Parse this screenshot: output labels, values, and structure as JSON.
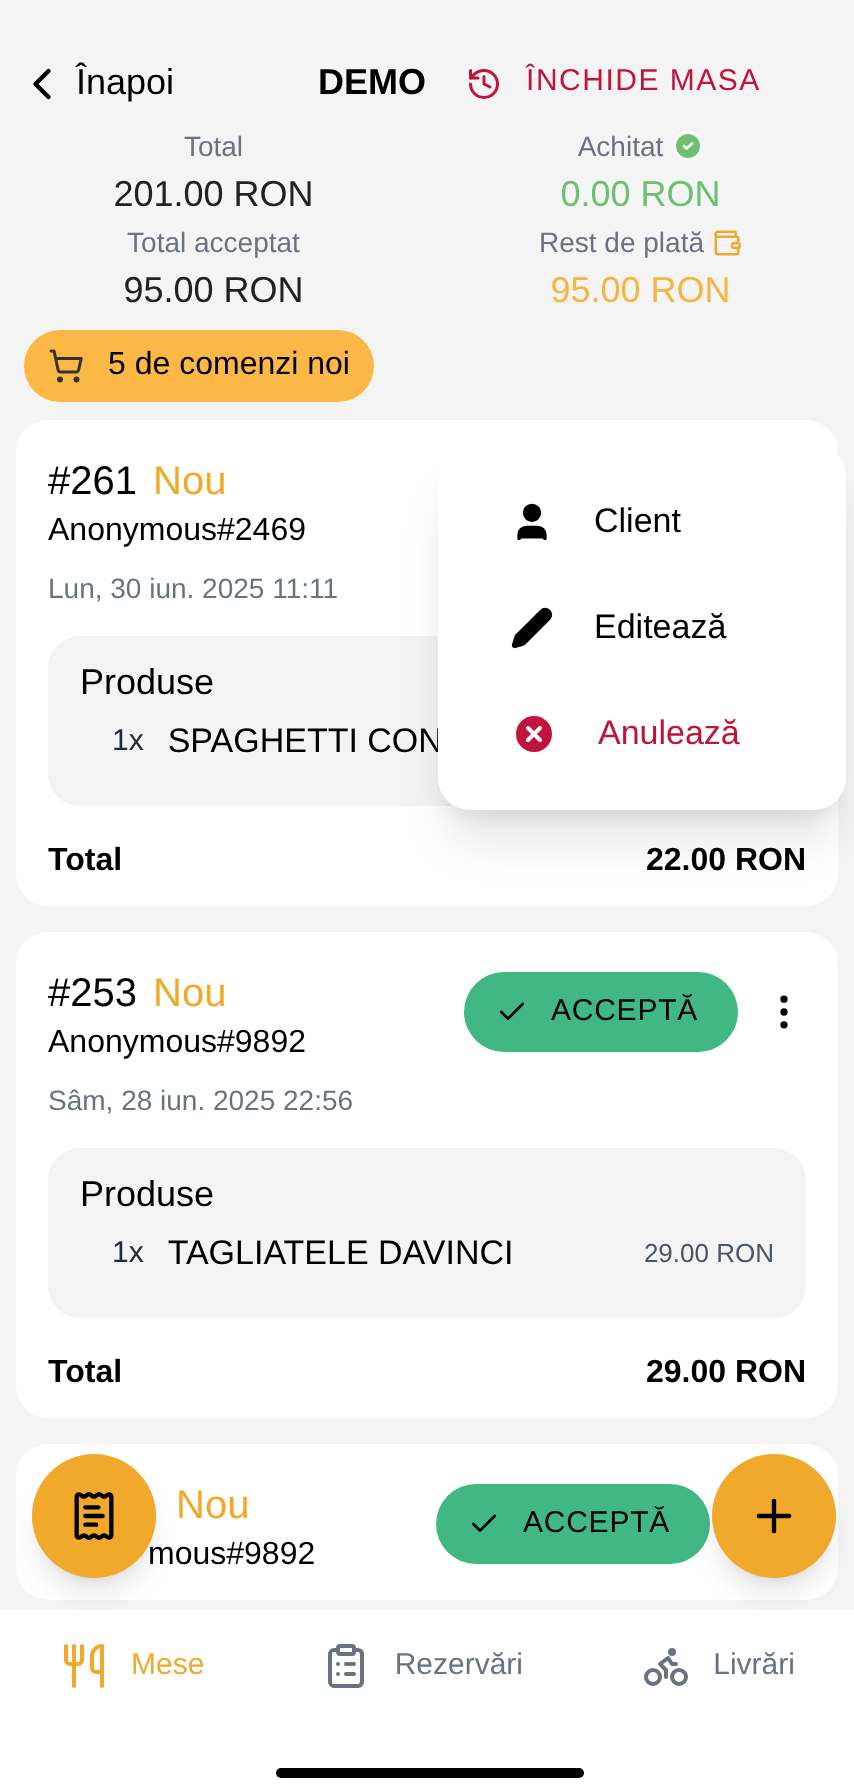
{
  "header": {
    "back_label": "Înapoi",
    "title": "DEMO",
    "close_label": "ÎNCHIDE MASA"
  },
  "summary": [
    {
      "label": "Total",
      "value": "201.00 RON",
      "kind": "plain"
    },
    {
      "label": "Achitat",
      "value": "0.00 RON",
      "kind": "paid"
    },
    {
      "label": "Total acceptat",
      "value": "95.00 RON",
      "kind": "plain"
    },
    {
      "label": "Rest de plată",
      "value": "95.00 RON",
      "kind": "due"
    }
  ],
  "new_orders_chip": "5 de comenzi noi",
  "orders": [
    {
      "number": "#261",
      "status": "Nou",
      "customer": "Anonymous#2469",
      "date": "Lun, 30 iun. 2025 11:11",
      "products_title": "Produse",
      "products": [
        {
          "qty": "1x",
          "name": "SPAGHETTI CON"
        }
      ],
      "total_label": "Total",
      "total": "22.00 RON"
    },
    {
      "number": "#253",
      "status": "Nou",
      "customer": "Anonymous#9892",
      "date": "Sâm, 28 iun. 2025 22:56",
      "accept_label": "ACCEPTĂ",
      "products_title": "Produse",
      "products": [
        {
          "qty": "1x",
          "name": "TAGLIATELE DAVINCI",
          "price": "29.00 RON"
        }
      ],
      "total_label": "Total",
      "total": "29.00 RON"
    },
    {
      "status": "Nou",
      "customer_cut": "mous#9892",
      "accept_label": "ACCEPTĂ"
    }
  ],
  "context_menu": [
    {
      "label": "Client",
      "kind": "person"
    },
    {
      "label": "Editează",
      "kind": "edit"
    },
    {
      "label": "Anulează",
      "kind": "cancel"
    }
  ],
  "bottom_nav": [
    {
      "label": "Mese",
      "kind": "tables",
      "selected": true
    },
    {
      "label": "Rezervări",
      "kind": "reservations",
      "selected": false
    },
    {
      "label": "Livrări",
      "kind": "delivery",
      "selected": false
    }
  ]
}
